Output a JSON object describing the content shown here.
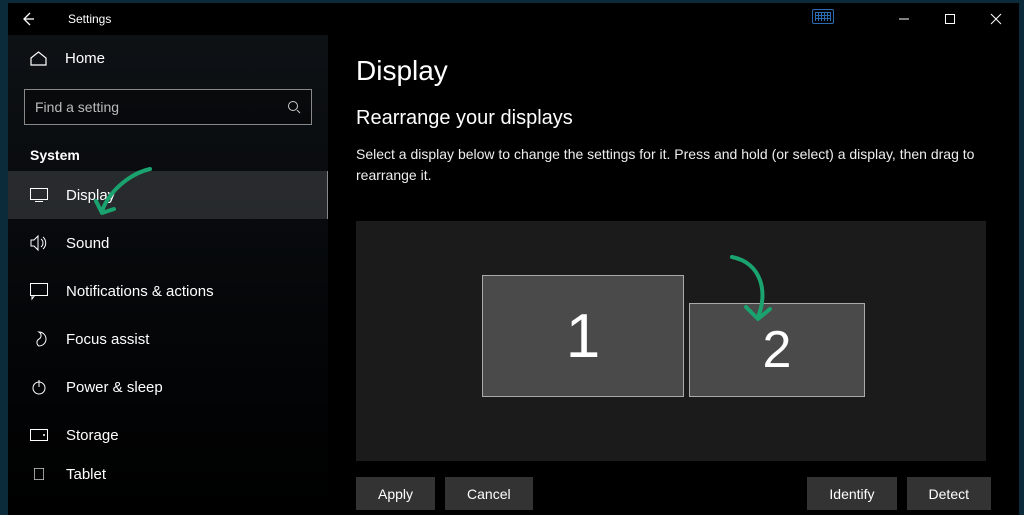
{
  "titlebar": {
    "title": "Settings"
  },
  "sidebar": {
    "home": "Home",
    "search_placeholder": "Find a setting",
    "section": "System",
    "items": [
      {
        "label": "Display",
        "selected": true,
        "icon": "display-icon"
      },
      {
        "label": "Sound",
        "selected": false,
        "icon": "sound-icon"
      },
      {
        "label": "Notifications & actions",
        "selected": false,
        "icon": "notifications-icon"
      },
      {
        "label": "Focus assist",
        "selected": false,
        "icon": "focus-icon"
      },
      {
        "label": "Power & sleep",
        "selected": false,
        "icon": "power-icon"
      },
      {
        "label": "Storage",
        "selected": false,
        "icon": "storage-icon"
      },
      {
        "label": "Tablet",
        "selected": false,
        "icon": "tablet-icon"
      }
    ]
  },
  "main": {
    "heading": "Display",
    "subheading": "Rearrange your displays",
    "description": "Select a display below to change the settings for it. Press and hold (or select) a display, then drag to rearrange it.",
    "monitors": [
      {
        "id": "1"
      },
      {
        "id": "2"
      }
    ],
    "buttons": {
      "apply": "Apply",
      "cancel": "Cancel",
      "identify": "Identify",
      "detect": "Detect"
    }
  },
  "annotations": {
    "arrow_color": "#1aa36f"
  }
}
